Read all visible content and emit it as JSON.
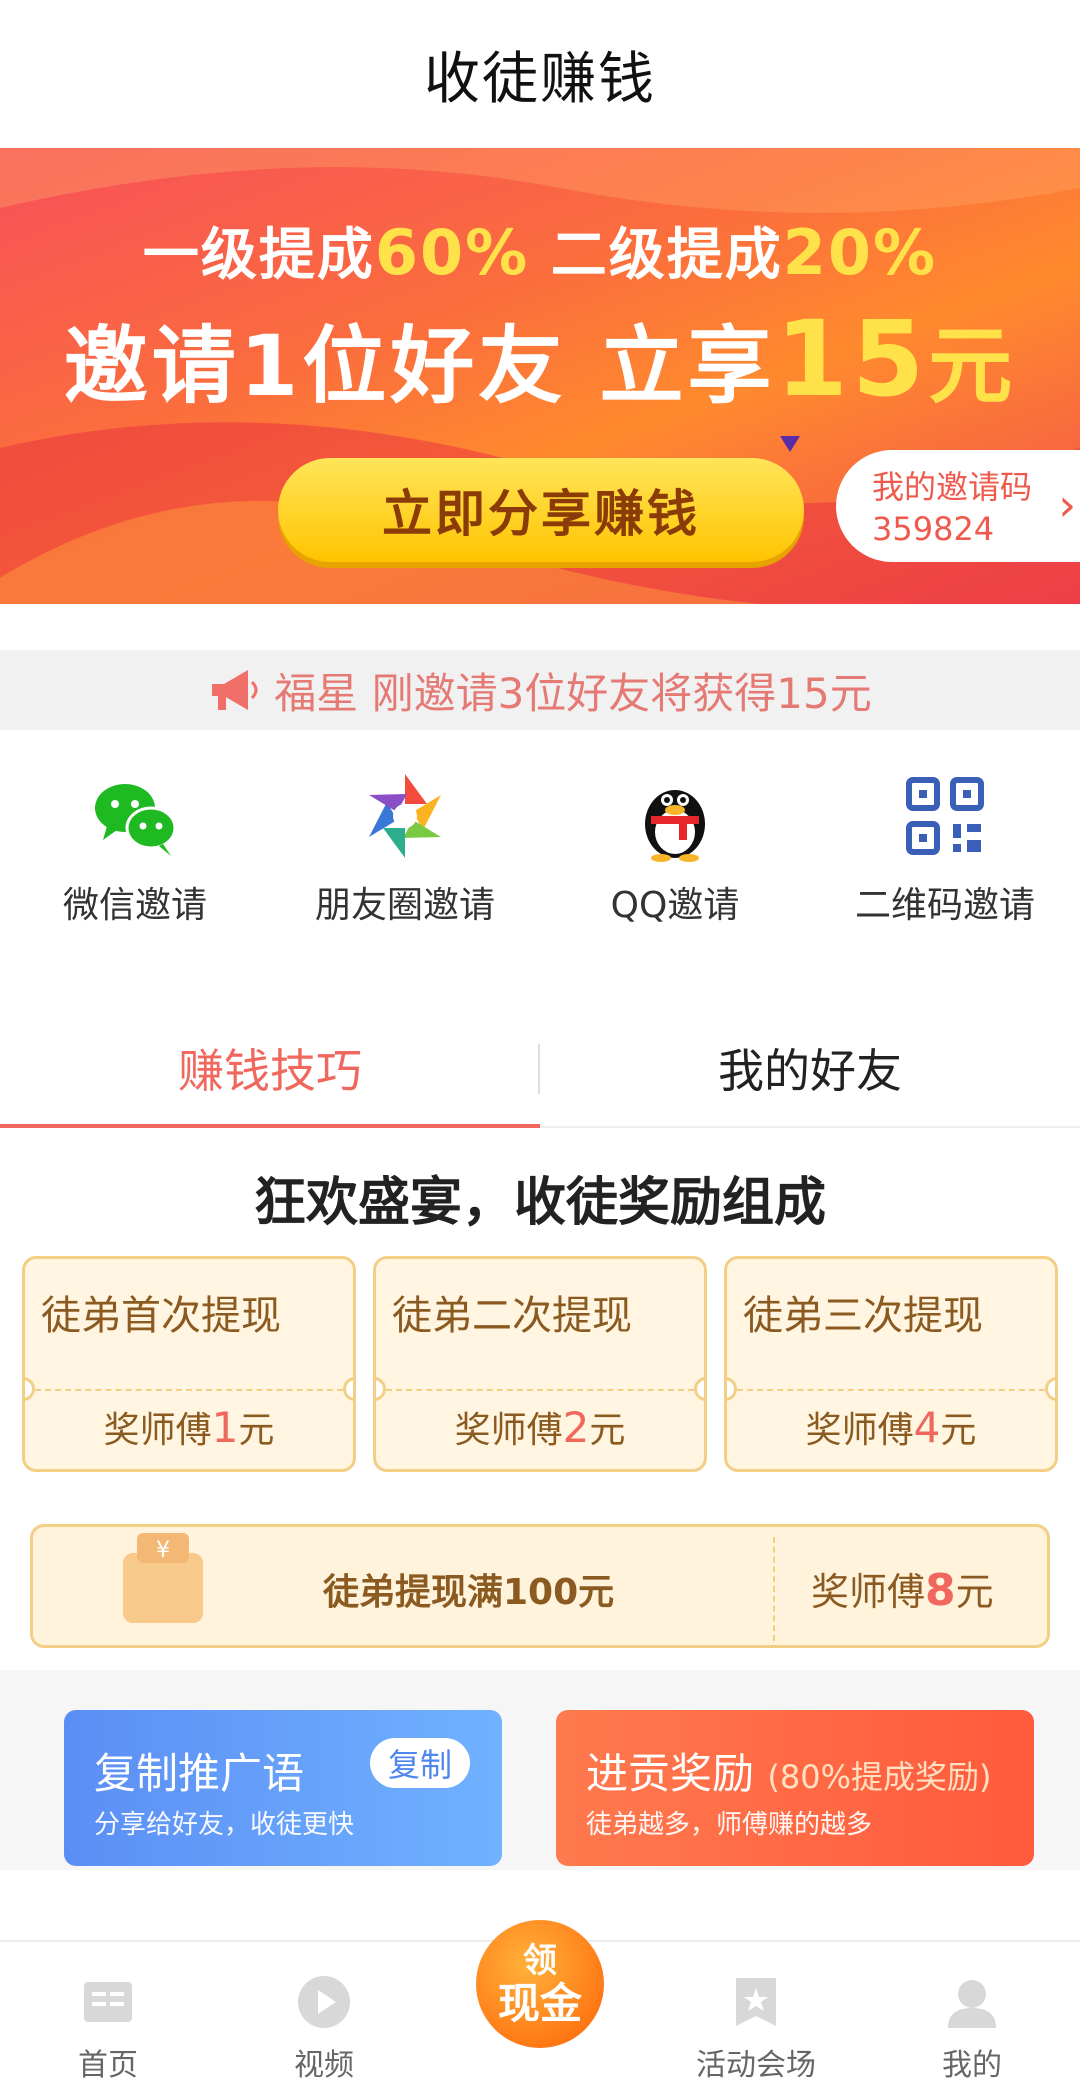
{
  "header": {
    "title": "收徒赚钱"
  },
  "banner": {
    "line1_part1": "一级提成",
    "line1_pct1": "60%",
    "line1_part2": "二级提成",
    "line1_pct2": "20%",
    "line2_part1": "邀请1位好友 立享",
    "line2_amount": "15",
    "line2_unit": "元",
    "share_button": "立即分享赚钱",
    "invite_code_label": "我的邀请码",
    "invite_code": "359824"
  },
  "notice": {
    "text": "福星 刚邀请3位好友将获得15元"
  },
  "invites": [
    {
      "label": "微信邀请",
      "icon": "wechat-icon"
    },
    {
      "label": "朋友圈邀请",
      "icon": "moments-icon"
    },
    {
      "label": "QQ邀请",
      "icon": "qq-icon"
    },
    {
      "label": "二维码邀请",
      "icon": "qrcode-icon"
    }
  ],
  "tabs": [
    {
      "label": "赚钱技巧",
      "active": true
    },
    {
      "label": "我的好友",
      "active": false
    }
  ],
  "section_title": "狂欢盛宴，收徒奖励组成",
  "rewards": [
    {
      "name": "徒弟首次提现",
      "prefix": "奖师傅",
      "amount": "1",
      "unit": "元"
    },
    {
      "name": "徒弟二次提现",
      "prefix": "奖师傅",
      "amount": "2",
      "unit": "元"
    },
    {
      "name": "徒弟三次提现",
      "prefix": "奖师傅",
      "amount": "4",
      "unit": "元"
    }
  ],
  "milestone": {
    "text": "徒弟提现满100元",
    "prefix": "奖师傅",
    "amount": "8",
    "unit": "元"
  },
  "promos": {
    "copy": {
      "title": "复制推广语",
      "button": "复制",
      "subtitle": "分享给好友，收徒更快"
    },
    "tribute": {
      "title": "进贡奖励",
      "title_sub": "(80%提成奖励)",
      "subtitle": "徒弟越多，师傅赚的越多"
    }
  },
  "bottom_nav": {
    "items": [
      {
        "label": "首页",
        "icon": "home-icon"
      },
      {
        "label": "视频",
        "icon": "video-icon"
      },
      {
        "label": "活动会场",
        "icon": "activity-icon"
      },
      {
        "label": "我的",
        "icon": "profile-icon"
      }
    ],
    "center_button": {
      "line1": "领",
      "line2": "现金"
    }
  },
  "colors": {
    "accent": "#f0675e",
    "banner_yellow": "#ffe14a",
    "card_border": "#f2cf85",
    "card_text": "#8b5a20"
  }
}
